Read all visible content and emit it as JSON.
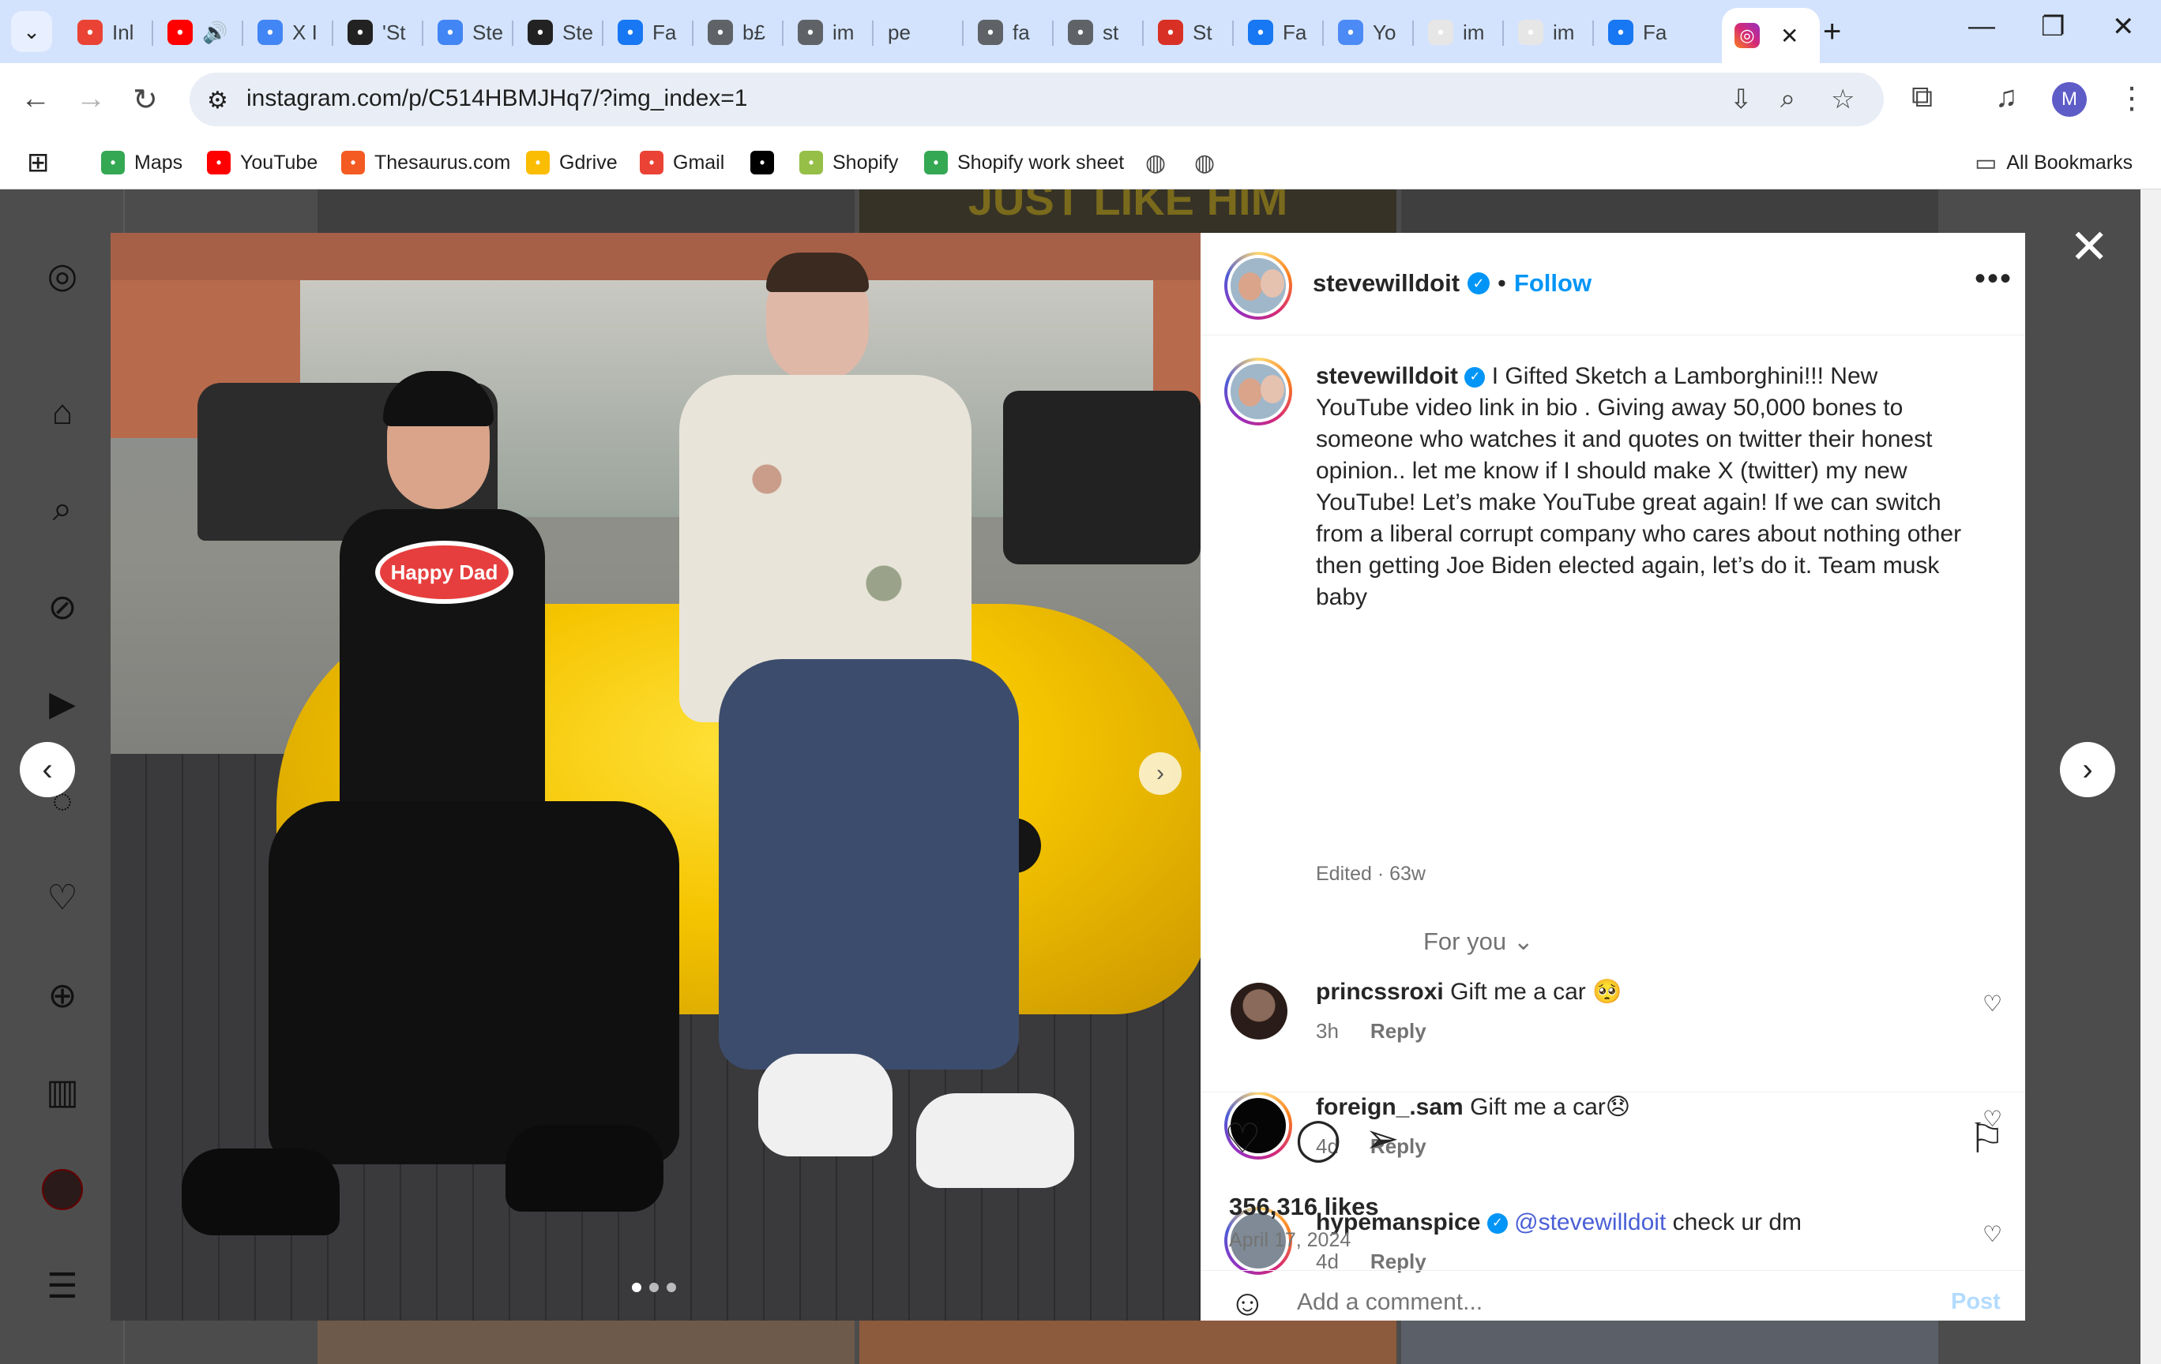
{
  "browser": {
    "tabs": [
      {
        "label": "Inl",
        "icon": "gmail-icon",
        "color": "#ea4335"
      },
      {
        "label": "",
        "icon": "youtube-icon",
        "color": "#ff0000",
        "audio": "🔊"
      },
      {
        "label": "X I",
        "icon": "docs-icon",
        "color": "#4285f4"
      },
      {
        "label": "'St",
        "icon": "l-icon",
        "color": "#222222"
      },
      {
        "label": "Ste",
        "icon": "google-icon",
        "color": "#4285f4"
      },
      {
        "label": "Ste",
        "icon": "iw-icon",
        "color": "#222222"
      },
      {
        "label": "Fa",
        "icon": "facebook-icon",
        "color": "#1877f2"
      },
      {
        "label": "b£",
        "icon": "globe-icon",
        "color": "#5f6368"
      },
      {
        "label": "im",
        "icon": "globe-icon",
        "color": "#5f6368"
      },
      {
        "label": "pe",
        "icon": "",
        "color": "#d3e3fd"
      },
      {
        "label": "fa",
        "icon": "globe-icon",
        "color": "#5f6368"
      },
      {
        "label": "st",
        "icon": "globe-icon",
        "color": "#5f6368"
      },
      {
        "label": "St",
        "icon": "m-icon",
        "color": "#d93025"
      },
      {
        "label": "Fa",
        "icon": "facebook-icon",
        "color": "#1877f2"
      },
      {
        "label": "Yo",
        "icon": "butterfly-icon",
        "color": "#4c8bf5"
      },
      {
        "label": "im",
        "icon": "instagram-icon",
        "color": "#e6e6e6"
      },
      {
        "label": "im",
        "icon": "instagram-icon",
        "color": "#e6e6e6"
      },
      {
        "label": "Fa",
        "icon": "facebook-icon",
        "color": "#1877f2"
      }
    ],
    "url": "instagram.com/p/C514HBMJHq7/?img_index=1",
    "profile_initial": "M",
    "bookmarks": [
      {
        "label": "Maps",
        "icon": "maps-icon",
        "color": "#34a853"
      },
      {
        "label": "YouTube",
        "icon": "youtube-icon",
        "color": "#ff0000"
      },
      {
        "label": "Thesaurus.com",
        "icon": "thesaurus-icon",
        "color": "#f35b22"
      },
      {
        "label": "Gdrive",
        "icon": "drive-icon",
        "color": "#fbbc04"
      },
      {
        "label": "Gmail",
        "icon": "gmail-icon",
        "color": "#ea4335"
      },
      {
        "label": "",
        "icon": "bbc-icon",
        "color": "#000000"
      },
      {
        "label": "Shopify",
        "icon": "shopify-icon",
        "color": "#95bf47"
      },
      {
        "label": "Shopify work sheet",
        "icon": "drive-icon",
        "color": "#34a853"
      }
    ],
    "all_bookmarks": "All Bookmarks"
  },
  "post": {
    "username": "stevewilldoit",
    "follow": "Follow",
    "caption": "I Gifted Sketch a Lamborghini!!! New YouTube video link in bio . Giving away 50,000 bones to someone who watches it and quotes on twitter their honest opinion.. let me know if I should make X (twitter) my new YouTube! Let’s make YouTube great again! If we can switch from a liberal corrupt company who cares about nothing other then getting Joe Biden elected again, let’s do it. Team musk baby",
    "edited": "Edited · 63w",
    "sort": "For you",
    "comments": [
      {
        "user": "princssroxi",
        "text": "Gift me a car 🥺",
        "time": "3h",
        "reply": "Reply"
      },
      {
        "user": "foreign_.sam",
        "text": "Gift me a car😞",
        "time": "4d",
        "reply": "Reply"
      },
      {
        "user": "hypemanspice",
        "mention": "@stevewilldoit",
        "text": "check ur dm",
        "time": "4d",
        "reply": "Reply"
      }
    ],
    "likes": "356,316 likes",
    "date": "April 17, 2024",
    "add_comment_placeholder": "Add a comment...",
    "post_button": "Post",
    "photo_index": 1,
    "photo_count": 3
  },
  "background_text": "JUST LIKE HIM",
  "colors": {
    "link_blue": "#0095f6",
    "mention_blue": "#00376b",
    "car_yellow": "#f5c400",
    "tab_strip": "#d3e3fd"
  }
}
